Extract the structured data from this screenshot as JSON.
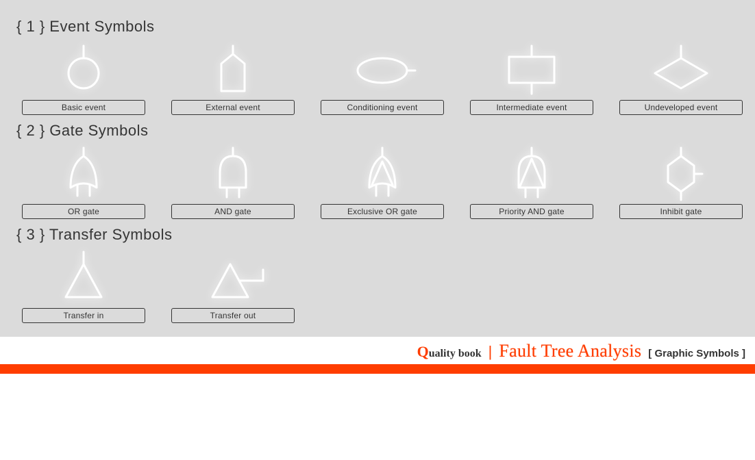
{
  "sections": [
    {
      "num": "1",
      "title": "Event Symbols"
    },
    {
      "num": "2",
      "title": "Gate Symbols"
    },
    {
      "num": "3",
      "title": "Transfer Symbols"
    }
  ],
  "events": [
    {
      "label": "Basic event"
    },
    {
      "label": "External event"
    },
    {
      "label": "Conditioning event"
    },
    {
      "label": "Intermediate event"
    },
    {
      "label": "Undeveloped event"
    }
  ],
  "gates": [
    {
      "label": "OR gate"
    },
    {
      "label": "AND gate"
    },
    {
      "label": "Exclusive OR gate"
    },
    {
      "label": "Priority AND gate"
    },
    {
      "label": "Inhibit gate"
    }
  ],
  "transfers": [
    {
      "label": "Transfer in"
    },
    {
      "label": "Transfer out"
    }
  ],
  "footer": {
    "brand_first": "Q",
    "brand_rest": "uality book",
    "separator": "|",
    "title": "Fault Tree Analysis",
    "subtitle": "[ Graphic Symbols ]"
  },
  "chart_data": {
    "type": "table",
    "title": "Fault Tree Analysis — Graphic Symbols",
    "groups": [
      {
        "name": "Event Symbols",
        "items": [
          {
            "name": "Basic event",
            "shape": "circle"
          },
          {
            "name": "External event",
            "shape": "house/pentagon"
          },
          {
            "name": "Conditioning event",
            "shape": "ellipse"
          },
          {
            "name": "Intermediate event",
            "shape": "rectangle"
          },
          {
            "name": "Undeveloped event",
            "shape": "diamond"
          }
        ]
      },
      {
        "name": "Gate Symbols",
        "items": [
          {
            "name": "OR gate",
            "shape": "or-gate (curved base, pointed top)"
          },
          {
            "name": "AND gate",
            "shape": "and-gate (flat base, rounded top)"
          },
          {
            "name": "Exclusive OR gate",
            "shape": "or-gate with inner triangle"
          },
          {
            "name": "Priority AND gate",
            "shape": "and-gate with inner triangle"
          },
          {
            "name": "Inhibit gate",
            "shape": "hexagon"
          }
        ]
      },
      {
        "name": "Transfer Symbols",
        "items": [
          {
            "name": "Transfer in",
            "shape": "triangle, line from apex"
          },
          {
            "name": "Transfer out",
            "shape": "triangle, line from side"
          }
        ]
      }
    ]
  }
}
